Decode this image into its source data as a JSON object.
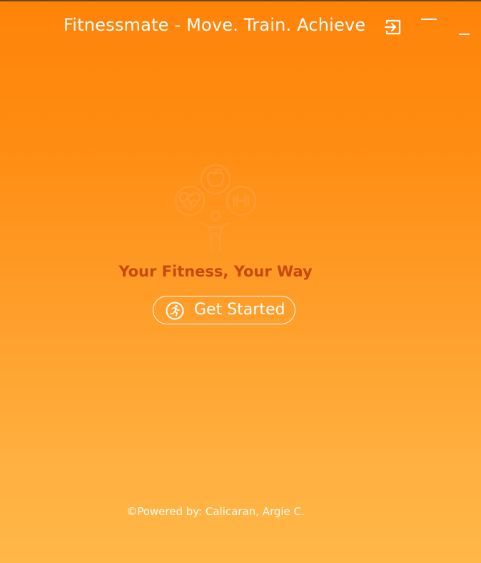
{
  "window": {
    "title": "Fitnessmate - Move. Train. Achieve",
    "controls": {
      "login_icon": "login-icon",
      "minimize_icon": "minimize-icon",
      "underscore_icon": "underscore-icon"
    }
  },
  "main": {
    "logo_icon": "fitness-person-icon",
    "slogan": "Your Fitness, Your Way",
    "cta": {
      "label": "Get Started",
      "icon": "running-person-icon"
    }
  },
  "footer": {
    "text": "©Powered by: Calicaran, Argie C."
  },
  "colors": {
    "gradient_top": "#ff8309",
    "gradient_bottom": "#ffb747",
    "slogan": "#c64a10",
    "text_light": "#ffffff",
    "logo": "#ff9a34"
  }
}
